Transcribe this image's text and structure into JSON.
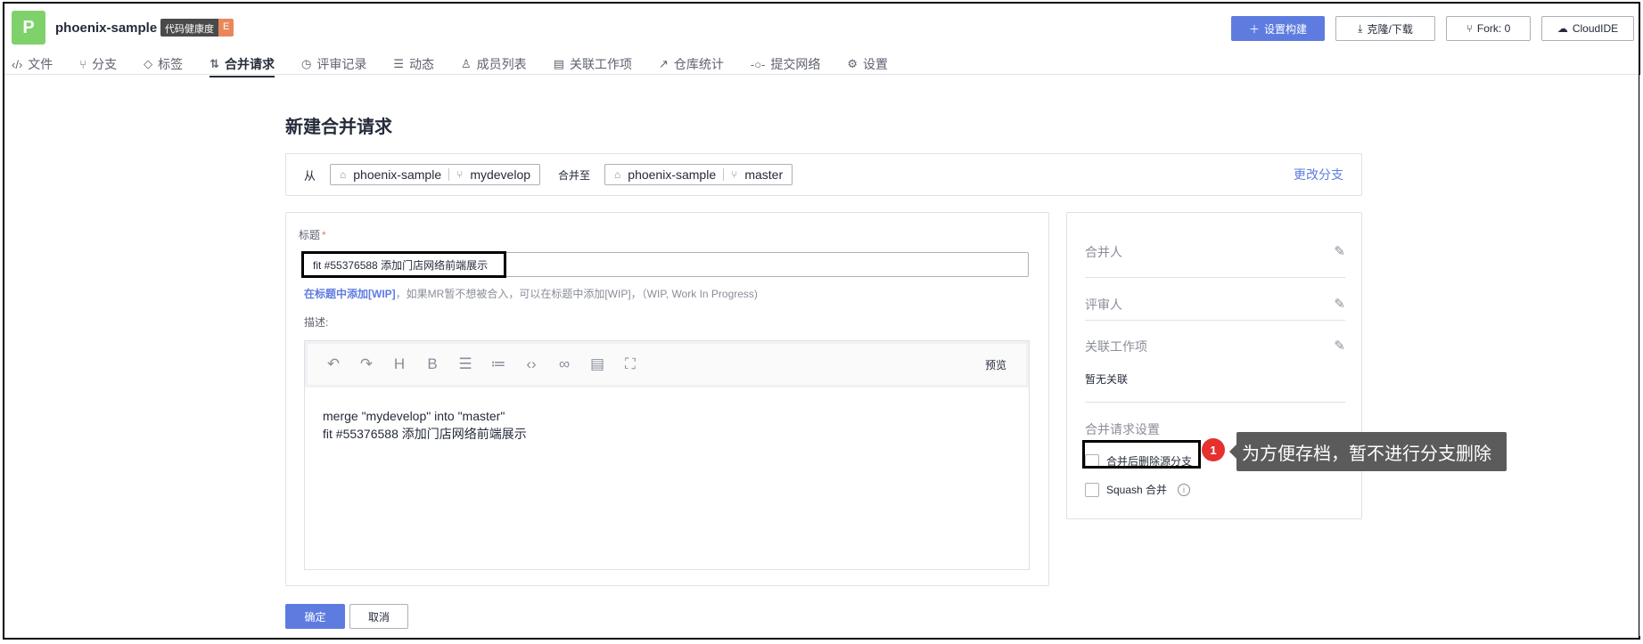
{
  "project": {
    "logo_letter": "P",
    "name": "phoenix-sample",
    "health_label": "代码健康度",
    "health_grade": "E"
  },
  "top_buttons": {
    "setup_build": "设置构建",
    "clone_download": "克隆/下载",
    "fork": "Fork: 0",
    "cloudide": "CloudIDE"
  },
  "nav": [
    {
      "label": "文件",
      "icon": "code-icon"
    },
    {
      "label": "分支",
      "icon": "branch-icon"
    },
    {
      "label": "标签",
      "icon": "tag-icon"
    },
    {
      "label": "合并请求",
      "icon": "merge-icon",
      "active": true
    },
    {
      "label": "评审记录",
      "icon": "clock-icon"
    },
    {
      "label": "动态",
      "icon": "list-icon"
    },
    {
      "label": "成员列表",
      "icon": "users-icon"
    },
    {
      "label": "关联工作项",
      "icon": "document-icon"
    },
    {
      "label": "仓库统计",
      "icon": "chart-icon"
    },
    {
      "label": "提交网络",
      "icon": "commit-icon"
    },
    {
      "label": "设置",
      "icon": "gear-icon"
    }
  ],
  "page_title": "新建合并请求",
  "branch_bar": {
    "from_label": "从",
    "source_repo": "phoenix-sample",
    "source_branch": "mydevelop",
    "merge_to_label": "合并至",
    "target_repo": "phoenix-sample",
    "target_branch": "master",
    "change_branch": "更改分支"
  },
  "form": {
    "title_label": "标题",
    "required_mark": "*",
    "title_value": "fit #55376588 添加门店网络前端展示",
    "hint_link": "在标题中添加[WIP]",
    "hint_text": "，如果MR暂不想被合入，可以在标题中添加[WIP]，（WIP, Work In Progress)",
    "desc_label": "描述:",
    "preview": "预览",
    "desc_line1": "merge \"mydevelop\" into \"master\"",
    "desc_line2": "fit #55376588 添加门店网络前端展示"
  },
  "sidebar": {
    "merger": "合并人",
    "reviewer": "评审人",
    "linked_items": "关联工作项",
    "no_link": "暂无关联",
    "settings_title": "合并请求设置",
    "delete_source_branch": "合并后删除源分支",
    "squash_merge": "Squash 合并"
  },
  "annotation": {
    "badge": "1",
    "tooltip": "为方便存档，暂不进行分支删除"
  },
  "actions": {
    "confirm": "确定",
    "cancel": "取消"
  },
  "colors": {
    "primary": "#5e7ce0",
    "logo": "#7fd16b",
    "grade": "#e8875a",
    "badge": "#e6312e",
    "tooltip": "#5b5b5b"
  }
}
